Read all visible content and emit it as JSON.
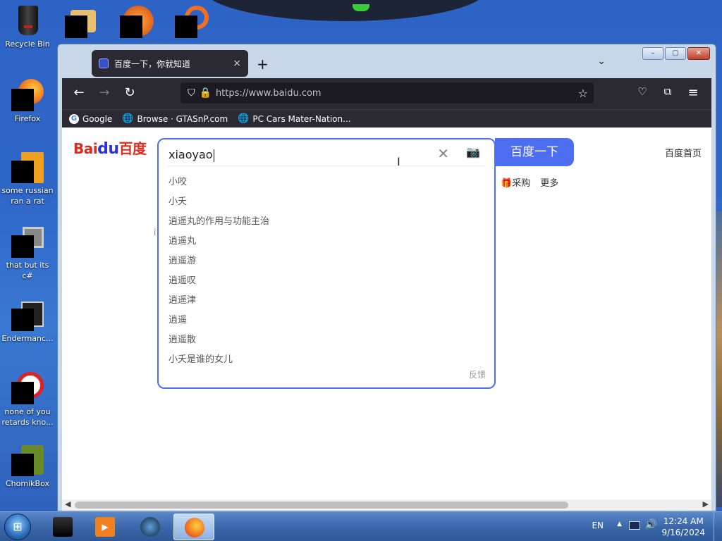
{
  "desktop": {
    "icons": [
      {
        "label": "Recycle Bin",
        "icon": "recycle-bin-icon"
      },
      {
        "label": "Firefox",
        "icon": "firefox-icon"
      },
      {
        "label": "some russian ran a rat",
        "icon": "file-icon"
      },
      {
        "label": "that but its c#",
        "icon": "folder-icon"
      },
      {
        "label": "Endermanc...",
        "icon": "app-icon"
      },
      {
        "label": "none of you retards kno...",
        "icon": "app-icon"
      },
      {
        "label": "ChomikBox",
        "icon": "chomikbox-icon"
      }
    ]
  },
  "window": {
    "controls": {
      "minimize": "–",
      "maximize": "▢",
      "close": "✕"
    }
  },
  "browser": {
    "tab": {
      "title": "百度一下，你就知道",
      "close": "×"
    },
    "new_tab": "+",
    "tab_list": "⌄",
    "url": "https://www.baidu.com",
    "bookmarks": [
      "Google",
      "Browse · GTASnP.com",
      "PC Cars Mater-Nation..."
    ]
  },
  "page": {
    "logo": {
      "bai": "Bai",
      "paw": "du",
      "brand": "百度"
    },
    "search": {
      "query": "xiaoyao",
      "button": "百度一下",
      "suggestions": [
        "小咬",
        "小夭",
        "逍遥丸的作用与功能主治",
        "逍遥丸",
        "逍遥游",
        "逍遥叹",
        "逍遥津",
        "逍遥",
        "逍遥散",
        "小夭是谁的女儿"
      ],
      "feedback": "反馈"
    },
    "home_link": "百度首页",
    "subnav": [
      "采购",
      "更多"
    ],
    "stray": "i"
  },
  "taskbar": {
    "lang": "EN",
    "time": "12:24 AM",
    "date": "9/16/2024"
  }
}
